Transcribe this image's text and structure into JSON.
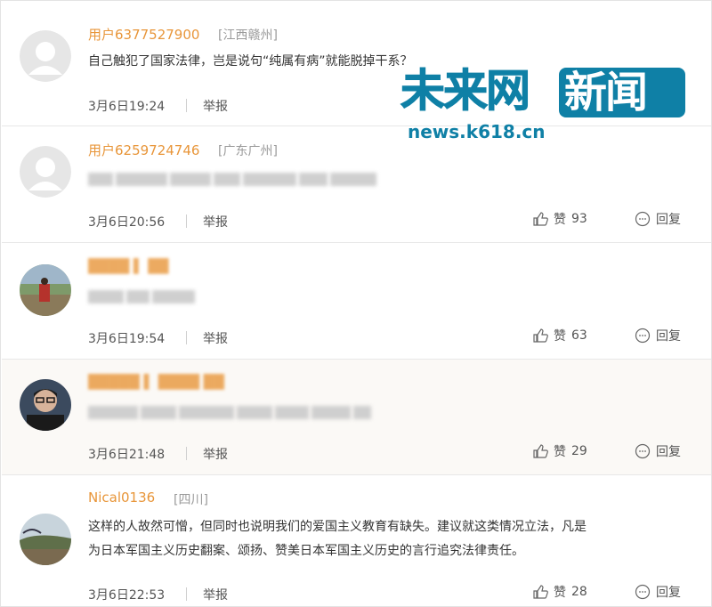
{
  "comments": [
    {
      "user": "用户6377527900",
      "region": "[江西赣州]",
      "text": "自己触犯了国家法律，岂是说句“纯属有病”就能脱掉干系？",
      "time": "3月6日19:24",
      "report": "举报"
    },
    {
      "user": "用户6259724746",
      "region": "[广东广州]",
      "time": "3月6日20:56",
      "report": "举报",
      "like_label": "赞",
      "likes": "93",
      "reply_label": "回复"
    },
    {
      "time": "3月6日19:54",
      "report": "举报",
      "like_label": "赞",
      "likes": "63",
      "reply_label": "回复"
    },
    {
      "time": "3月6日21:48",
      "report": "举报",
      "like_label": "赞",
      "likes": "29",
      "reply_label": "回复"
    },
    {
      "user": "Nical0136",
      "region": "[四川]",
      "text_line1": "这样的人故然可憎，但同时也说明我们的爱国主义教育有缺失。建议就这类情况立法，凡是",
      "text_line2": "为日本军国主义历史翻案、颂扬、赞美日本军国主义历史的言行追究法律责任。",
      "time": "3月6日22:53",
      "report": "举报",
      "like_label": "赞",
      "likes": "28",
      "reply_label": "回复"
    }
  ],
  "watermark": {
    "brand_left": "未来网",
    "brand_right": "新闻",
    "url": "news.k618.cn",
    "color": "#0f80a6"
  },
  "colors": {
    "username": "#e8963a",
    "region": "#9a9a9a",
    "divider": "#e8e8e8"
  },
  "icons": {
    "like": "thumbs-up-icon",
    "reply": "speech-bubble-icon"
  }
}
